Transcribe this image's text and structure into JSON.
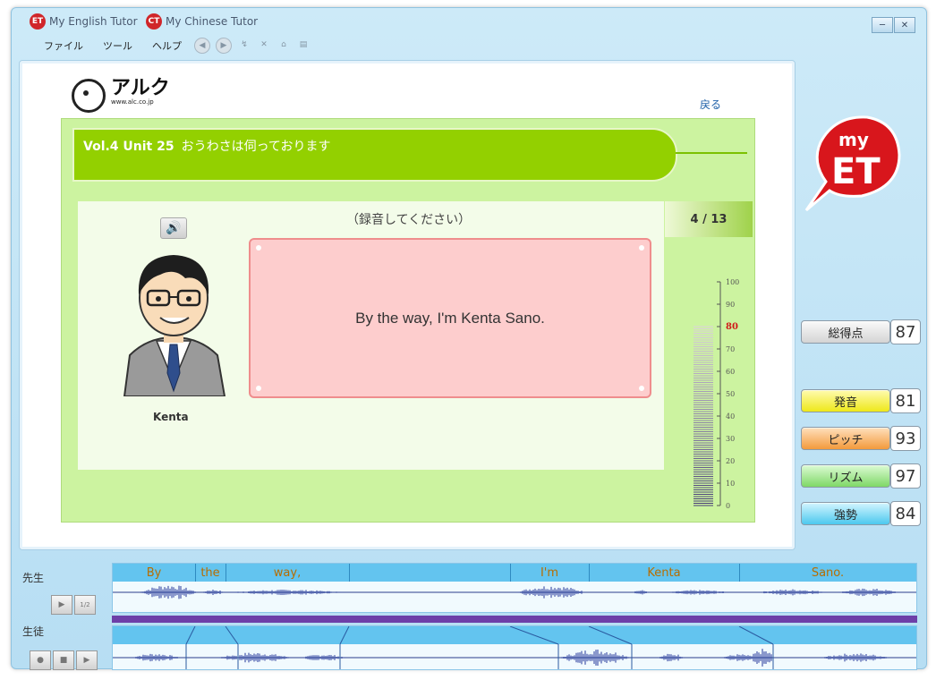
{
  "app_links": [
    {
      "label": "My English Tutor"
    },
    {
      "label": "My Chinese Tutor"
    }
  ],
  "menu": [
    "ファイル",
    "ツール",
    "ヘルプ"
  ],
  "content": {
    "logo_text": "アルク",
    "logo_url": "www.alc.co.jp",
    "back_label": "戻る",
    "lesson_vol": "Vol.4 Unit 25",
    "lesson_title": "おうわさは伺っております",
    "instruction": "（録音してください）",
    "counter": "4 / 13",
    "sentence": "By the way, I'm Kenta Sano.",
    "character_name": "Kenta"
  },
  "meter": {
    "ticks": [
      "100",
      "90",
      "80",
      "70",
      "60",
      "50",
      "40",
      "30",
      "20",
      "10",
      "0"
    ],
    "level": 80
  },
  "mascot": {
    "text_top": "my",
    "text_bottom": "ET"
  },
  "scores": {
    "total": {
      "label": "総得点",
      "value": "87"
    },
    "items": [
      {
        "label": "発音",
        "value": "81",
        "color": "#f6f03a"
      },
      {
        "label": "ピッチ",
        "value": "93",
        "color": "#f8ad55"
      },
      {
        "label": "リズム",
        "value": "97",
        "color": "#8fe27a"
      },
      {
        "label": "強勢",
        "value": "84",
        "color": "#5fd3f2"
      }
    ]
  },
  "wave": {
    "teacher_label": "先生",
    "student_label": "生徒",
    "words": [
      "By",
      "the",
      "way,",
      "",
      "I'm",
      "Kenta",
      "Sano."
    ],
    "slow_label": "1/2"
  }
}
